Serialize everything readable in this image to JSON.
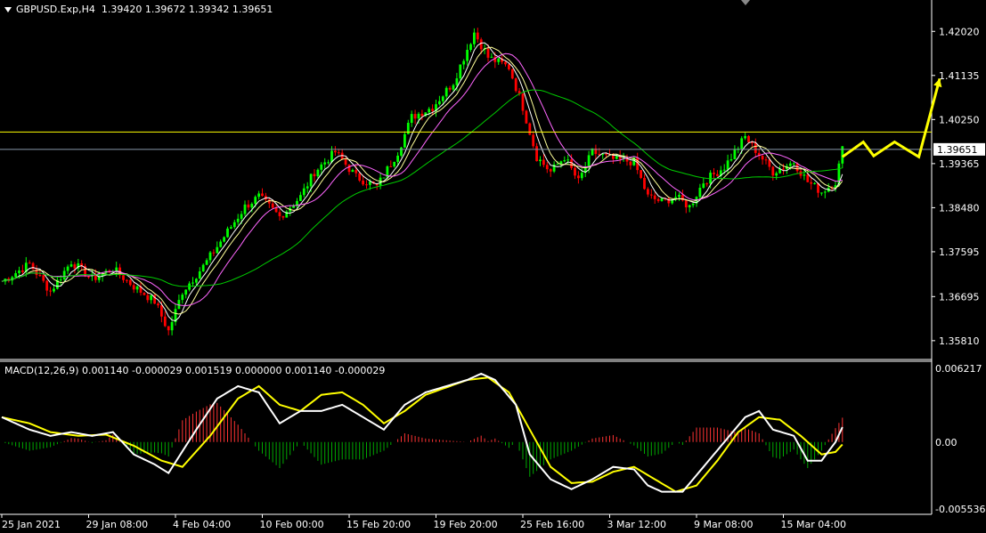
{
  "header": {
    "symbol": "GBPUSD.Exp,H4",
    "ohlc": "1.39420 1.39672 1.39342 1.39651"
  },
  "macd_header": {
    "label": "MACD(12,26,9) 0.001140 -0.000029 0.001519 0.000000 0.001140 -0.000029"
  },
  "colors": {
    "background": "#000000",
    "bull": "#00ff00",
    "bear": "#ff0000",
    "ma_fast": "#ffffff",
    "ma_mid": "#ffff99",
    "ma_slow": "#ff66ff",
    "ma_long": "#00cc00",
    "forecast": "#ffff00",
    "hline": "#ffff00",
    "bid_line": "#8899aa",
    "price_tag_bg": "#ffffff",
    "macd_main": "#ffffff",
    "macd_signal": "#ffff00",
    "hist_pos": "#ff3333",
    "hist_neg": "#00aa00"
  },
  "chart_data": [
    {
      "type": "candlestick",
      "timeframe": "H4",
      "price_ticks": [
        "1.42020",
        "1.41135",
        "1.40250",
        "1.39365",
        "1.38480",
        "1.37595",
        "1.36695",
        "1.35810"
      ],
      "ylim": [
        1.3545,
        1.4265
      ],
      "current_price_label": "1.39651",
      "current_price": 1.39651,
      "hline_level": 1.4,
      "x_ticks": [
        "25 Jan 2021",
        "29 Jan 08:00",
        "4 Feb 04:00",
        "10 Feb 00:00",
        "15 Feb 20:00",
        "19 Feb 20:00",
        "25 Feb 16:00",
        "3 Mar 12:00",
        "9 Mar 08:00",
        "15 Mar 04:00"
      ],
      "x_tick_bar_index": [
        0,
        25,
        50,
        75,
        100,
        125,
        150,
        175,
        200,
        225
      ],
      "close_path": [
        [
          0,
          1.37
        ],
        [
          8,
          1.3735
        ],
        [
          14,
          1.368
        ],
        [
          20,
          1.374
        ],
        [
          26,
          1.3705
        ],
        [
          32,
          1.3725
        ],
        [
          38,
          1.369
        ],
        [
          44,
          1.366
        ],
        [
          48,
          1.36
        ],
        [
          52,
          1.368
        ],
        [
          58,
          1.373
        ],
        [
          64,
          1.379
        ],
        [
          70,
          1.385
        ],
        [
          74,
          1.387
        ],
        [
          80,
          1.383
        ],
        [
          86,
          1.387
        ],
        [
          90,
          1.392
        ],
        [
          96,
          1.396
        ],
        [
          102,
          1.391
        ],
        [
          108,
          1.389
        ],
        [
          114,
          1.396
        ],
        [
          118,
          1.403
        ],
        [
          124,
          1.405
        ],
        [
          130,
          1.41
        ],
        [
          136,
          1.42
        ],
        [
          140,
          1.415
        ],
        [
          146,
          1.413
        ],
        [
          150,
          1.405
        ],
        [
          154,
          1.395
        ],
        [
          158,
          1.392
        ],
        [
          162,
          1.395
        ],
        [
          166,
          1.39
        ],
        [
          170,
          1.396
        ],
        [
          176,
          1.3945
        ],
        [
          182,
          1.394
        ],
        [
          186,
          1.387
        ],
        [
          190,
          1.386
        ],
        [
          194,
          1.387
        ],
        [
          198,
          1.385
        ],
        [
          202,
          1.39
        ],
        [
          208,
          1.393
        ],
        [
          214,
          1.399
        ],
        [
          218,
          1.3955
        ],
        [
          222,
          1.392
        ],
        [
          228,
          1.394
        ],
        [
          232,
          1.39
        ],
        [
          236,
          1.388
        ],
        [
          240,
          1.39
        ],
        [
          242,
          1.3965
        ]
      ],
      "forecast_arrow": [
        [
          242,
          1.395
        ],
        [
          248,
          1.398
        ],
        [
          251,
          1.3952
        ],
        [
          257,
          1.398
        ],
        [
          264,
          1.395
        ],
        [
          270,
          1.4107
        ]
      ]
    },
    {
      "type": "macd",
      "params": "MACD(12,26,9)",
      "y_ticks": [
        "0.006217",
        "0.00",
        "-0.005536"
      ],
      "ylim": [
        -0.005536,
        0.006217
      ],
      "main": [
        [
          0,
          0.002
        ],
        [
          8,
          0.001
        ],
        [
          14,
          0.0005
        ],
        [
          20,
          0.0008
        ],
        [
          26,
          0.0005
        ],
        [
          32,
          0.0008
        ],
        [
          38,
          -0.001
        ],
        [
          44,
          -0.0018
        ],
        [
          48,
          -0.0025
        ],
        [
          56,
          0.001
        ],
        [
          62,
          0.0035
        ],
        [
          68,
          0.0045
        ],
        [
          74,
          0.004
        ],
        [
          80,
          0.0015
        ],
        [
          86,
          0.0025
        ],
        [
          92,
          0.0025
        ],
        [
          98,
          0.003
        ],
        [
          104,
          0.002
        ],
        [
          110,
          0.001
        ],
        [
          116,
          0.003
        ],
        [
          122,
          0.004
        ],
        [
          128,
          0.0045
        ],
        [
          134,
          0.005
        ],
        [
          138,
          0.0055
        ],
        [
          142,
          0.005
        ],
        [
          148,
          0.003
        ],
        [
          152,
          -0.001
        ],
        [
          158,
          -0.003
        ],
        [
          164,
          -0.0038
        ],
        [
          170,
          -0.003
        ],
        [
          176,
          -0.002
        ],
        [
          182,
          -0.0022
        ],
        [
          186,
          -0.0035
        ],
        [
          190,
          -0.004
        ],
        [
          196,
          -0.004
        ],
        [
          202,
          -0.002
        ],
        [
          208,
          0.0
        ],
        [
          214,
          0.002
        ],
        [
          218,
          0.0025
        ],
        [
          222,
          0.001
        ],
        [
          228,
          0.0005
        ],
        [
          232,
          -0.0015
        ],
        [
          236,
          -0.0015
        ],
        [
          240,
          0.0
        ],
        [
          242,
          0.0012
        ]
      ],
      "signal": [
        [
          0,
          0.002
        ],
        [
          8,
          0.0015
        ],
        [
          14,
          0.0008
        ],
        [
          22,
          0.0005
        ],
        [
          30,
          0.0006
        ],
        [
          38,
          -0.0003
        ],
        [
          46,
          -0.0015
        ],
        [
          52,
          -0.002
        ],
        [
          60,
          0.0005
        ],
        [
          68,
          0.0035
        ],
        [
          74,
          0.0045
        ],
        [
          80,
          0.003
        ],
        [
          86,
          0.0025
        ],
        [
          92,
          0.0038
        ],
        [
          98,
          0.004
        ],
        [
          104,
          0.003
        ],
        [
          110,
          0.0015
        ],
        [
          116,
          0.0025
        ],
        [
          122,
          0.0038
        ],
        [
          128,
          0.0044
        ],
        [
          134,
          0.005
        ],
        [
          140,
          0.0052
        ],
        [
          146,
          0.004
        ],
        [
          152,
          0.001
        ],
        [
          158,
          -0.002
        ],
        [
          164,
          -0.0033
        ],
        [
          170,
          -0.0032
        ],
        [
          176,
          -0.0024
        ],
        [
          182,
          -0.002
        ],
        [
          188,
          -0.003
        ],
        [
          194,
          -0.004
        ],
        [
          200,
          -0.0035
        ],
        [
          206,
          -0.0015
        ],
        [
          212,
          0.0008
        ],
        [
          218,
          0.002
        ],
        [
          224,
          0.0018
        ],
        [
          230,
          0.0005
        ],
        [
          236,
          -0.001
        ],
        [
          240,
          -0.0008
        ],
        [
          242,
          -0.0002
        ]
      ]
    }
  ]
}
